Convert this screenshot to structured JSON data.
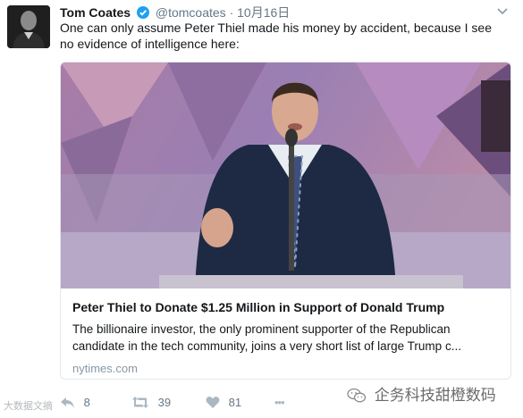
{
  "tweet": {
    "display_name": "Tom Coates",
    "handle": "@tomcoates",
    "separator": "·",
    "date": "10月16日",
    "text": "One can only assume Peter Thiel made his money by accident, because I see no evidence of intelligence here:"
  },
  "card": {
    "title": "Peter Thiel to Donate $1.25 Million in Support of Donald Trump",
    "description": "The billionaire investor, the only prominent supporter of the Republican candidate in the tech community, joins a very short list of large Trump c...",
    "domain": "nytimes.com"
  },
  "actions": {
    "reply_count": "8",
    "retweet_count": "39",
    "like_count": "81",
    "more_label": "•••"
  },
  "watermarks": {
    "left": "大数据文摘",
    "right": "企务科技甜橙数码"
  },
  "colors": {
    "verified": "#1da1f2",
    "secondary_text": "#657786",
    "card_border": "#e1e8ed"
  }
}
